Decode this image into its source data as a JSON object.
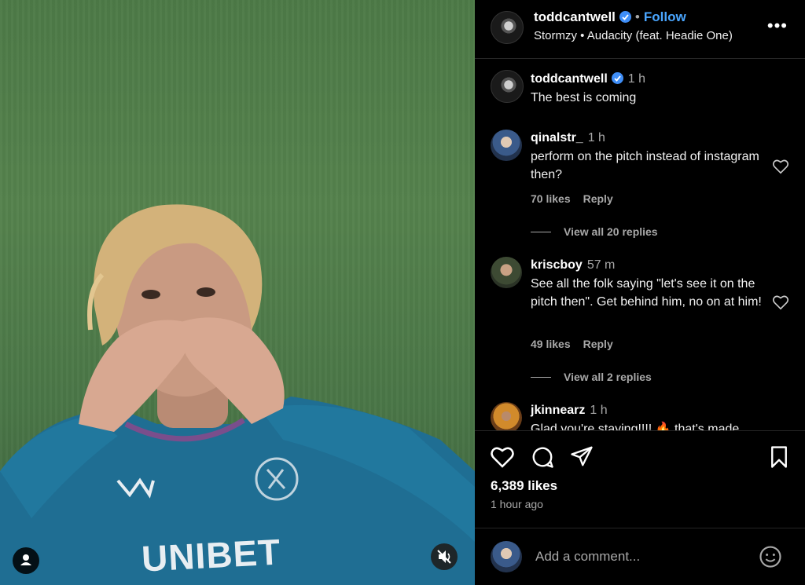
{
  "header": {
    "username": "toddcantwell",
    "follow_label": "Follow",
    "song": "Stormzy • Audacity (feat. Headie One)"
  },
  "caption": {
    "username": "toddcantwell",
    "time": "1 h",
    "text": "The best is coming"
  },
  "comments": [
    {
      "username": "qinalstr_",
      "time": "1 h",
      "text": "perform on the pitch instead of instagram then?",
      "likes": "70 likes",
      "reply_label": "Reply",
      "view_replies": "View all 20 replies"
    },
    {
      "username": "kriscboy",
      "time": "57 m",
      "text": "See all the folk saying \"let's see it on the pitch then\". Get behind him, no on at him!",
      "likes": "49 likes",
      "reply_label": "Reply",
      "view_replies": "View all 2 replies"
    },
    {
      "username": "jkinnearz",
      "time": "1 h",
      "text": "Glad you're staying!!!! 🔥 that's made"
    }
  ],
  "post": {
    "likes": "6,389 likes",
    "time_ago": "1 hour ago"
  },
  "comment_input": {
    "placeholder": "Add a comment..."
  },
  "media": {
    "shirt_text": "UNIBET"
  },
  "colors": {
    "accent": "#4aa6ff",
    "verified": "#3f8ef7",
    "kit": "#1f6e93"
  }
}
